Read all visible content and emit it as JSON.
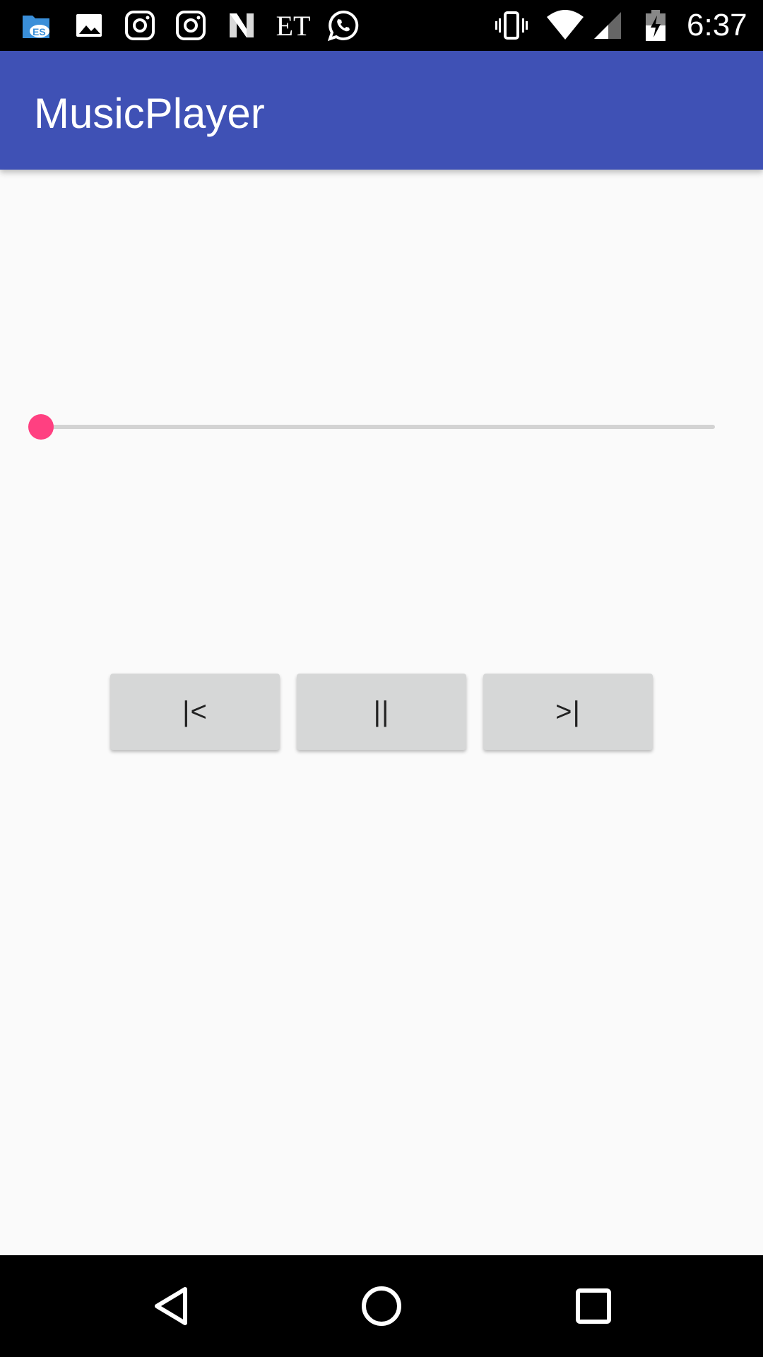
{
  "status_bar": {
    "time": "6:37",
    "notification_icons": [
      "es-file-explorer-icon",
      "gallery-icon",
      "instagram-icon",
      "instagram-icon",
      "netflix-n-icon",
      "economic-times-icon",
      "whatsapp-icon"
    ],
    "et_label": "ET",
    "system_icons": [
      "vibrate-icon",
      "wifi-icon",
      "cell-signal-icon",
      "battery-charging-icon"
    ]
  },
  "app_bar": {
    "title": "MusicPlayer",
    "color": "#3f51b5"
  },
  "player": {
    "seek_progress": 0,
    "accent_color": "#ff4081",
    "prev_label": "|<",
    "pause_label": "||",
    "next_label": ">|"
  },
  "nav_bar": {
    "icons": [
      "back-icon",
      "home-icon",
      "recents-icon"
    ]
  }
}
